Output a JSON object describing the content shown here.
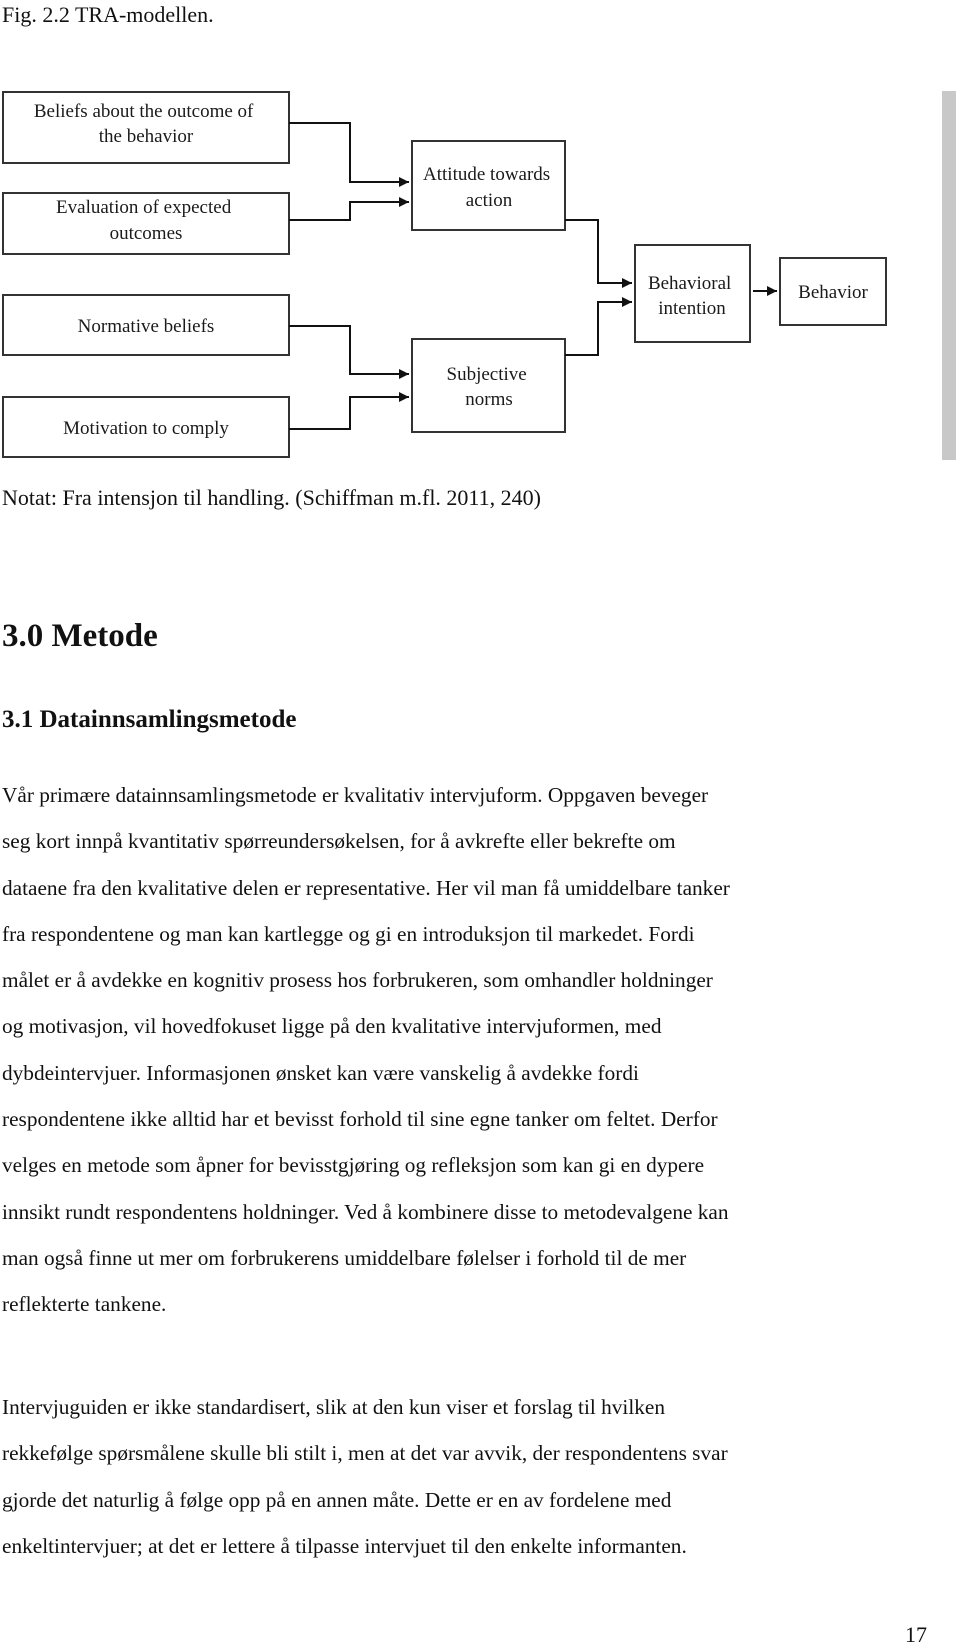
{
  "figure": {
    "title": "Fig. 2.2 TRA-modellen.",
    "caption": "Notat: Fra intensjon til handling. (Schiffman m.fl. 2011, 240)",
    "nodes": [
      {
        "id": "beliefs",
        "lines": [
          "Beliefs about the outcome of",
          "the behavior"
        ]
      },
      {
        "id": "evaluation",
        "lines": [
          "Evaluation of expected",
          "outcomes"
        ]
      },
      {
        "id": "normative",
        "lines": [
          "Normative beliefs"
        ]
      },
      {
        "id": "motivation",
        "lines": [
          "Motivation to comply"
        ]
      },
      {
        "id": "attitude",
        "lines": [
          "Attitude towards",
          "action"
        ]
      },
      {
        "id": "subjective",
        "lines": [
          "Subjective",
          "norms"
        ]
      },
      {
        "id": "intention",
        "lines": [
          "Behavioral",
          "intention"
        ]
      },
      {
        "id": "behavior",
        "lines": [
          "Behavior"
        ]
      }
    ],
    "edges": [
      {
        "from": "beliefs",
        "to": "attitude"
      },
      {
        "from": "evaluation",
        "to": "attitude"
      },
      {
        "from": "normative",
        "to": "subjective"
      },
      {
        "from": "motivation",
        "to": "subjective"
      },
      {
        "from": "attitude",
        "to": "intention"
      },
      {
        "from": "subjective",
        "to": "intention"
      },
      {
        "from": "intention",
        "to": "behavior"
      }
    ]
  },
  "headings": {
    "h1": "3.0 Metode",
    "h2": "3.1 Datainnsamlingsmetode"
  },
  "paragraphs": [
    {
      "lines": [
        "Vår primære datainnsamlingsmetode er kvalitativ intervjuform. Oppgaven beveger",
        "seg kort innpå kvantitativ spørreundersøkelsen, for å avkrefte eller bekrefte om",
        "dataene fra den kvalitative delen er representative. Her vil man få umiddelbare tanker",
        "fra respondentene og man kan kartlegge og gi en introduksjon til markedet. Fordi",
        "målet er å avdekke en kognitiv prosess hos forbrukeren, som omhandler holdninger",
        "og motivasjon, vil hovedfokuset ligge på den kvalitative intervjuformen, med",
        "dybdeintervjuer. Informasjonen ønsket kan være vanskelig å avdekke fordi",
        "respondentene ikke alltid har et bevisst forhold til sine egne tanker om feltet. Derfor",
        "velges en metode som åpner for bevisstgjøring og refleksjon som kan gi en dypere",
        "innsikt rundt respondentens holdninger. Ved å kombinere disse to metodevalgene kan",
        "man også finne ut mer om forbrukerens umiddelbare følelser i forhold til de mer",
        "reflekterte tankene."
      ]
    },
    {
      "lines": [
        "Intervjuguiden er ikke standardisert, slik at den kun viser et forslag til hvilken",
        "rekkefølge spørsmålene skulle bli stilt i, men at det var avvik, der respondentens svar",
        "gjorde det naturlig å følge opp på en annen måte. Dette er en av fordelene med",
        "enkeltintervjuer; at det er lettere å tilpasse intervjuet til den enkelte informanten."
      ]
    }
  ],
  "footer": {
    "page_number": "17"
  }
}
